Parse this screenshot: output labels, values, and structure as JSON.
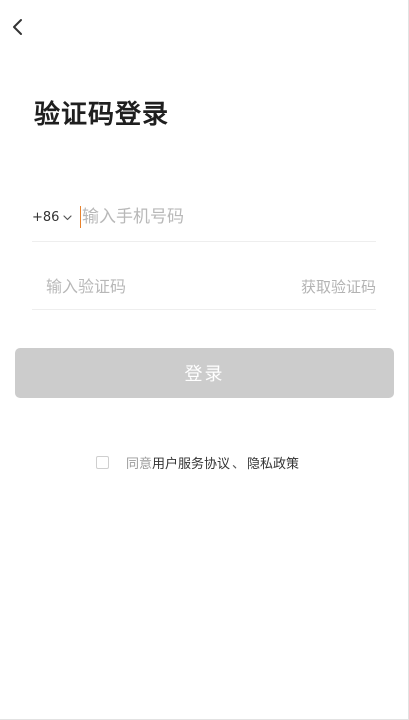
{
  "icons": {
    "back": "chevron-left-icon",
    "dropdown": "chevron-down-icon"
  },
  "colors": {
    "caret": "#e8822c",
    "button_disabled": "#cccccc",
    "placeholder": "#b8b8b8"
  },
  "page": {
    "title": "验证码登录"
  },
  "phone": {
    "country_code": "+86",
    "placeholder": "输入手机号码",
    "value": ""
  },
  "code": {
    "placeholder": "输入验证码",
    "value": "",
    "get_code_label": "获取验证码"
  },
  "login": {
    "label": "登录"
  },
  "agreement": {
    "checked": false,
    "prefix": "同意",
    "service_link": "用户服务协议",
    "separator": "、",
    "privacy_link": "隐私政策"
  }
}
